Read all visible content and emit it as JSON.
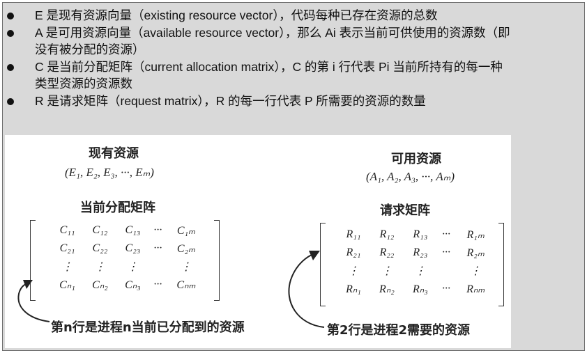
{
  "bullets": [
    {
      "line1": "E 是现有资源向量（existing resource vector），代码每种已存在资源的总数",
      "line2": ""
    },
    {
      "line1": "A 是可用资源向量（available resource vector），那么 Ai 表示当前可供使用的资源数（即",
      "line2": "没有被分配的资源）"
    },
    {
      "line1": "C 是当前分配矩阵（current allocation matrix），C 的第 i 行代表 Pi 当前所持有的每一种",
      "line2": "类型资源的资源数"
    },
    {
      "line1": "R 是请求矩阵（request matrix），R 的每一行代表 P 所需要的资源的数量",
      "line2": ""
    }
  ],
  "figure": {
    "left": {
      "title": "现有资源",
      "vector": "(E₁, E₂, E₃, ···, Eₘ)",
      "matrix_title": "当前分配矩阵",
      "rows": [
        [
          "C₁₁",
          "C₁₂",
          "C₁₃",
          "···",
          "C₁ₘ"
        ],
        [
          "C₂₁",
          "C₂₂",
          "C₂₃",
          "···",
          "C₂ₘ"
        ],
        [
          "⋮",
          "⋮",
          "⋮",
          "",
          "⋮"
        ],
        [
          "Cₙ₁",
          "Cₙ₂",
          "Cₙ₃",
          "···",
          "Cₙₘ"
        ]
      ],
      "caption": "第n行是进程n当前已分配到的资源"
    },
    "right": {
      "title": "可用资源",
      "vector": "(A₁, A₂, A₃, ···, Aₘ)",
      "matrix_title": "请求矩阵",
      "rows": [
        [
          "R₁₁",
          "R₁₂",
          "R₁₃",
          "···",
          "R₁ₘ"
        ],
        [
          "R₂₁",
          "R₂₂",
          "R₂₃",
          "···",
          "R₂ₘ"
        ],
        [
          "⋮",
          "⋮",
          "⋮",
          "",
          "⋮"
        ],
        [
          "Rₙ₁",
          "Rₙ₂",
          "Rₙ₃",
          "···",
          "Rₙₘ"
        ]
      ],
      "caption": "第2行是进程2需要的资源"
    }
  }
}
